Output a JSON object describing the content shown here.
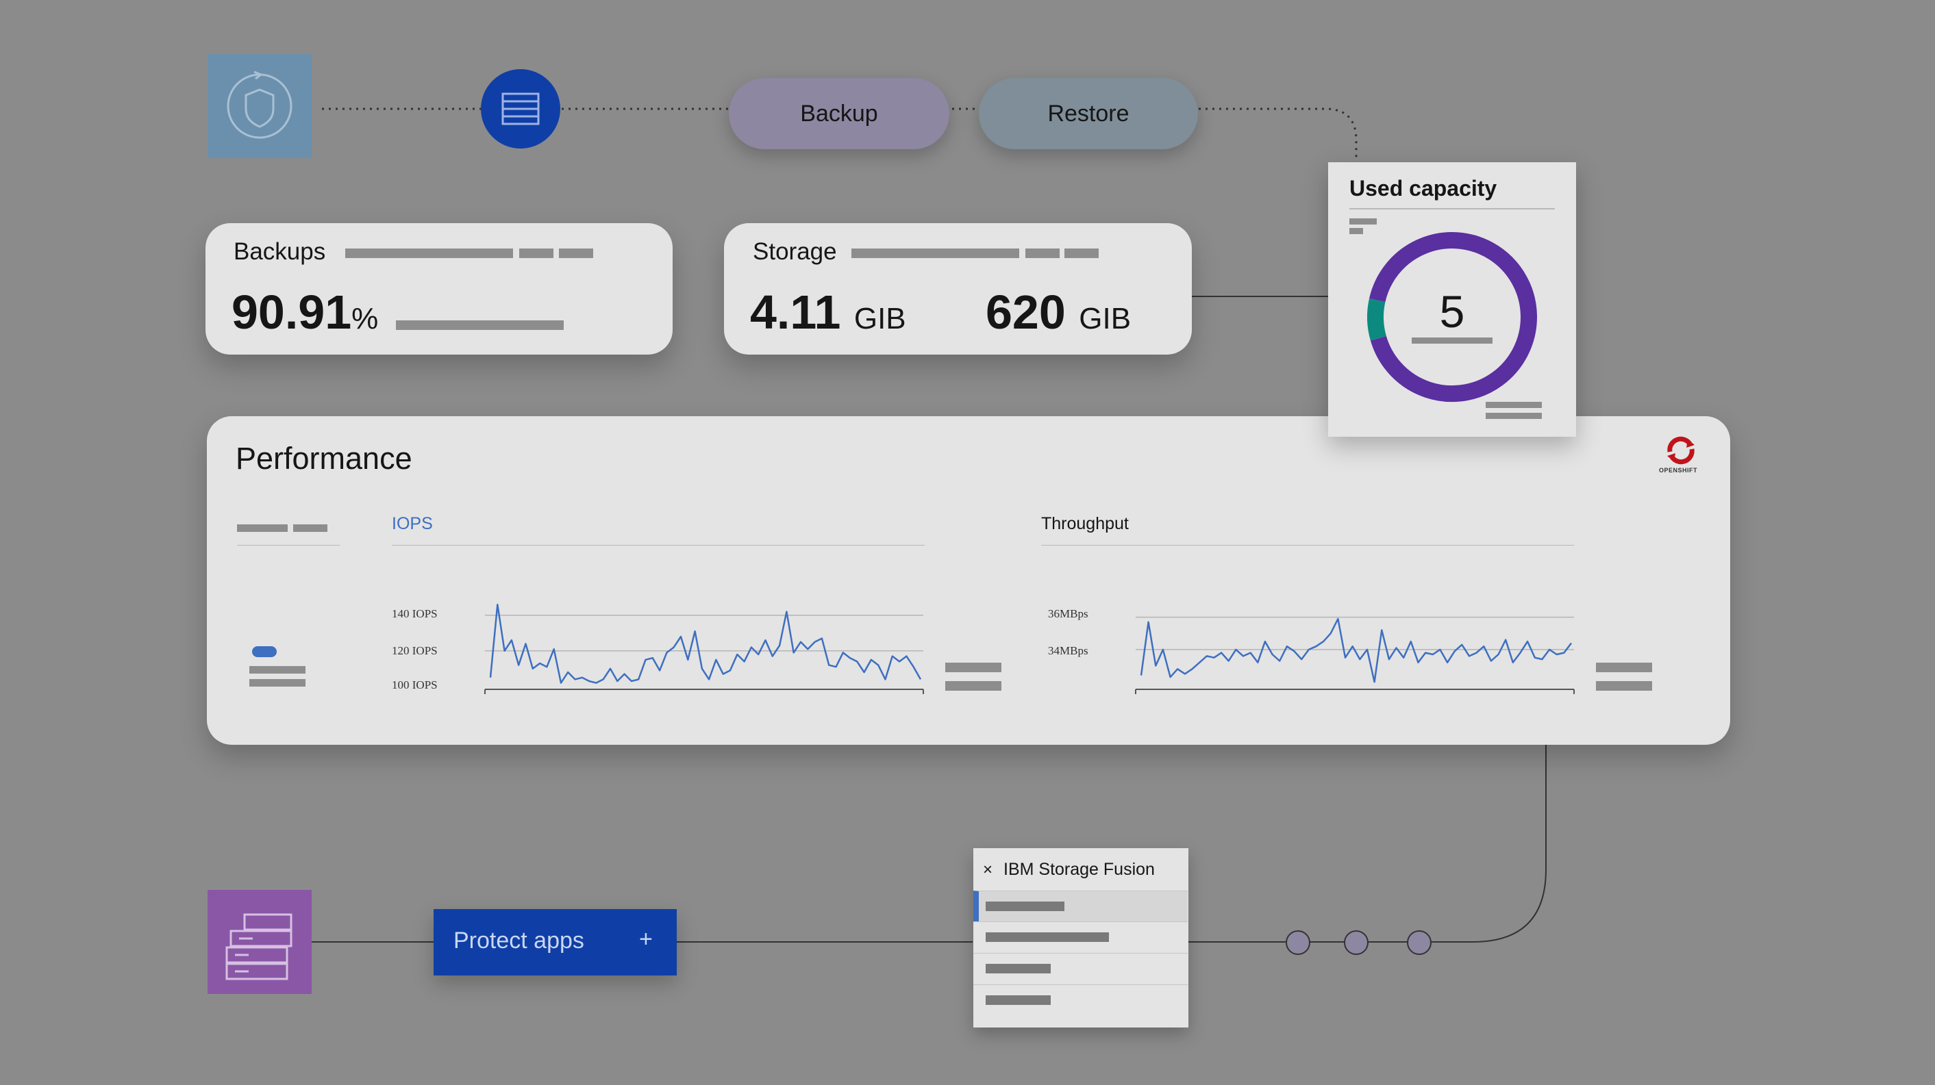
{
  "flow": {
    "backup_label": "Backup",
    "restore_label": "Restore",
    "pill_colors": {
      "backup": "#8d87a2",
      "restore": "#7f8e98"
    },
    "icon_colors": {
      "shield_tile": "#6b90ad",
      "server_circle": "#0f3fa6",
      "apps_tile": "#8a57a6"
    }
  },
  "backups_card": {
    "title": "Backups",
    "value": "90.91",
    "unit": "%"
  },
  "storage_card": {
    "title": "Storage",
    "value_1": "4.11",
    "unit_1": "GIB",
    "value_2": "620",
    "unit_2": "GIB"
  },
  "capacity": {
    "title": "Used capacity",
    "center_value": "5",
    "ring_color": "#5a2fa0",
    "accent_color": "#0d8a80"
  },
  "performance": {
    "title": "Performance",
    "logo_caption": "OPENSHIFT",
    "iops": {
      "label": "IOPS",
      "ticks": [
        "140 IOPS",
        "120 IOPS",
        "100 IOPS"
      ]
    },
    "throughput": {
      "label": "Throughput",
      "ticks": [
        "36MBps",
        "34MBps"
      ]
    }
  },
  "protect": {
    "label": "Protect apps",
    "plus": "+"
  },
  "fusion_menu": {
    "close": "×",
    "title": "IBM Storage Fusion"
  },
  "chart_data": [
    {
      "type": "line",
      "title": "IOPS",
      "ylabel": "",
      "yticks": [
        "100 IOPS",
        "120 IOPS",
        "140 IOPS"
      ],
      "ylim": [
        98,
        148
      ],
      "series": [
        {
          "values": [
            105,
            146,
            120,
            126,
            112,
            124,
            110,
            113,
            111,
            121,
            102,
            108,
            104,
            105,
            103,
            102,
            104,
            110,
            103,
            107,
            103,
            104,
            115,
            116,
            109,
            119,
            122,
            128,
            115,
            131,
            110,
            104,
            115,
            107,
            109,
            118,
            114,
            122,
            118,
            126,
            117,
            123,
            142,
            119,
            125,
            121,
            125,
            127,
            112,
            111,
            119,
            116,
            114,
            108,
            115,
            112,
            104,
            117,
            114,
            117,
            111,
            104
          ]
        }
      ]
    },
    {
      "type": "line",
      "title": "Throughput",
      "ylabel": "",
      "yticks": [
        "34MBps",
        "36MBps"
      ],
      "ylim": [
        31.5,
        37
      ],
      "series": [
        {
          "values": [
            32.4,
            35.7,
            33.0,
            34.0,
            32.3,
            32.8,
            32.5,
            32.8,
            33.2,
            33.6,
            33.5,
            33.8,
            33.3,
            34.0,
            33.6,
            33.8,
            33.2,
            34.5,
            33.7,
            33.3,
            34.2,
            33.9,
            33.4,
            34.0,
            34.2,
            34.5,
            35.0,
            35.9,
            33.5,
            34.2,
            33.4,
            34.0,
            32.0,
            35.2,
            33.4,
            34.1,
            33.5,
            34.5,
            33.2,
            33.8,
            33.7,
            34.0,
            33.2,
            33.9,
            34.3,
            33.6,
            33.8,
            34.2,
            33.3,
            33.7,
            34.6,
            33.2,
            33.8,
            34.5,
            33.5,
            33.4,
            34.0,
            33.7,
            33.8,
            34.4
          ]
        }
      ]
    },
    {
      "type": "pie",
      "title": "Used capacity",
      "center_label": "5",
      "slices": [
        {
          "value": 92,
          "color": "#5a2fa0"
        },
        {
          "value": 8,
          "color": "#0d8a80"
        }
      ]
    }
  ]
}
